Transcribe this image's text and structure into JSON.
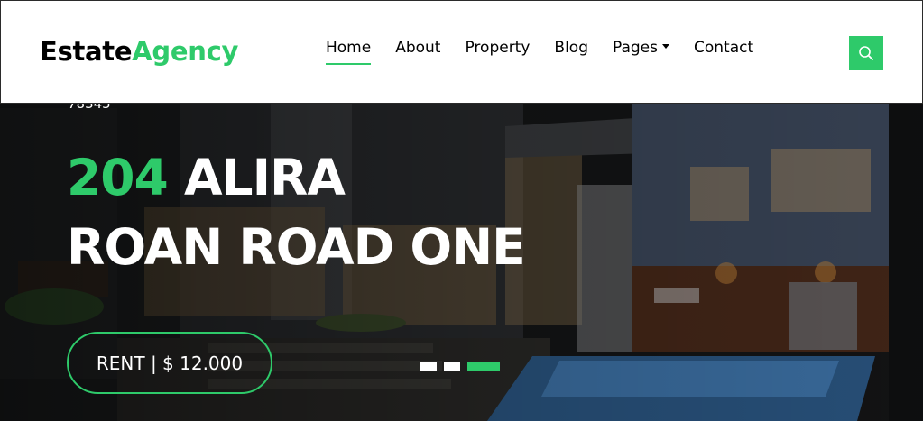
{
  "brand": {
    "main": "Estate",
    "accent": "Agency"
  },
  "nav": {
    "items": [
      {
        "label": "Home",
        "active": true
      },
      {
        "label": "About",
        "active": false
      },
      {
        "label": "Property",
        "active": false
      },
      {
        "label": "Blog",
        "active": false
      },
      {
        "label": "Pages",
        "active": false,
        "dropdown": true
      },
      {
        "label": "Contact",
        "active": false
      }
    ],
    "search_icon": "search-icon"
  },
  "hero": {
    "zip": "78345",
    "title_number": "204",
    "title_rest_line1": " ALIRA",
    "title_line2": "ROAN ROAD ONE",
    "price_label": "RENT | $ 12.000",
    "slides": [
      {
        "active": false
      },
      {
        "active": false
      },
      {
        "active": true
      }
    ]
  },
  "colors": {
    "accent": "#2eca6a",
    "text": "#000000",
    "white": "#ffffff"
  }
}
